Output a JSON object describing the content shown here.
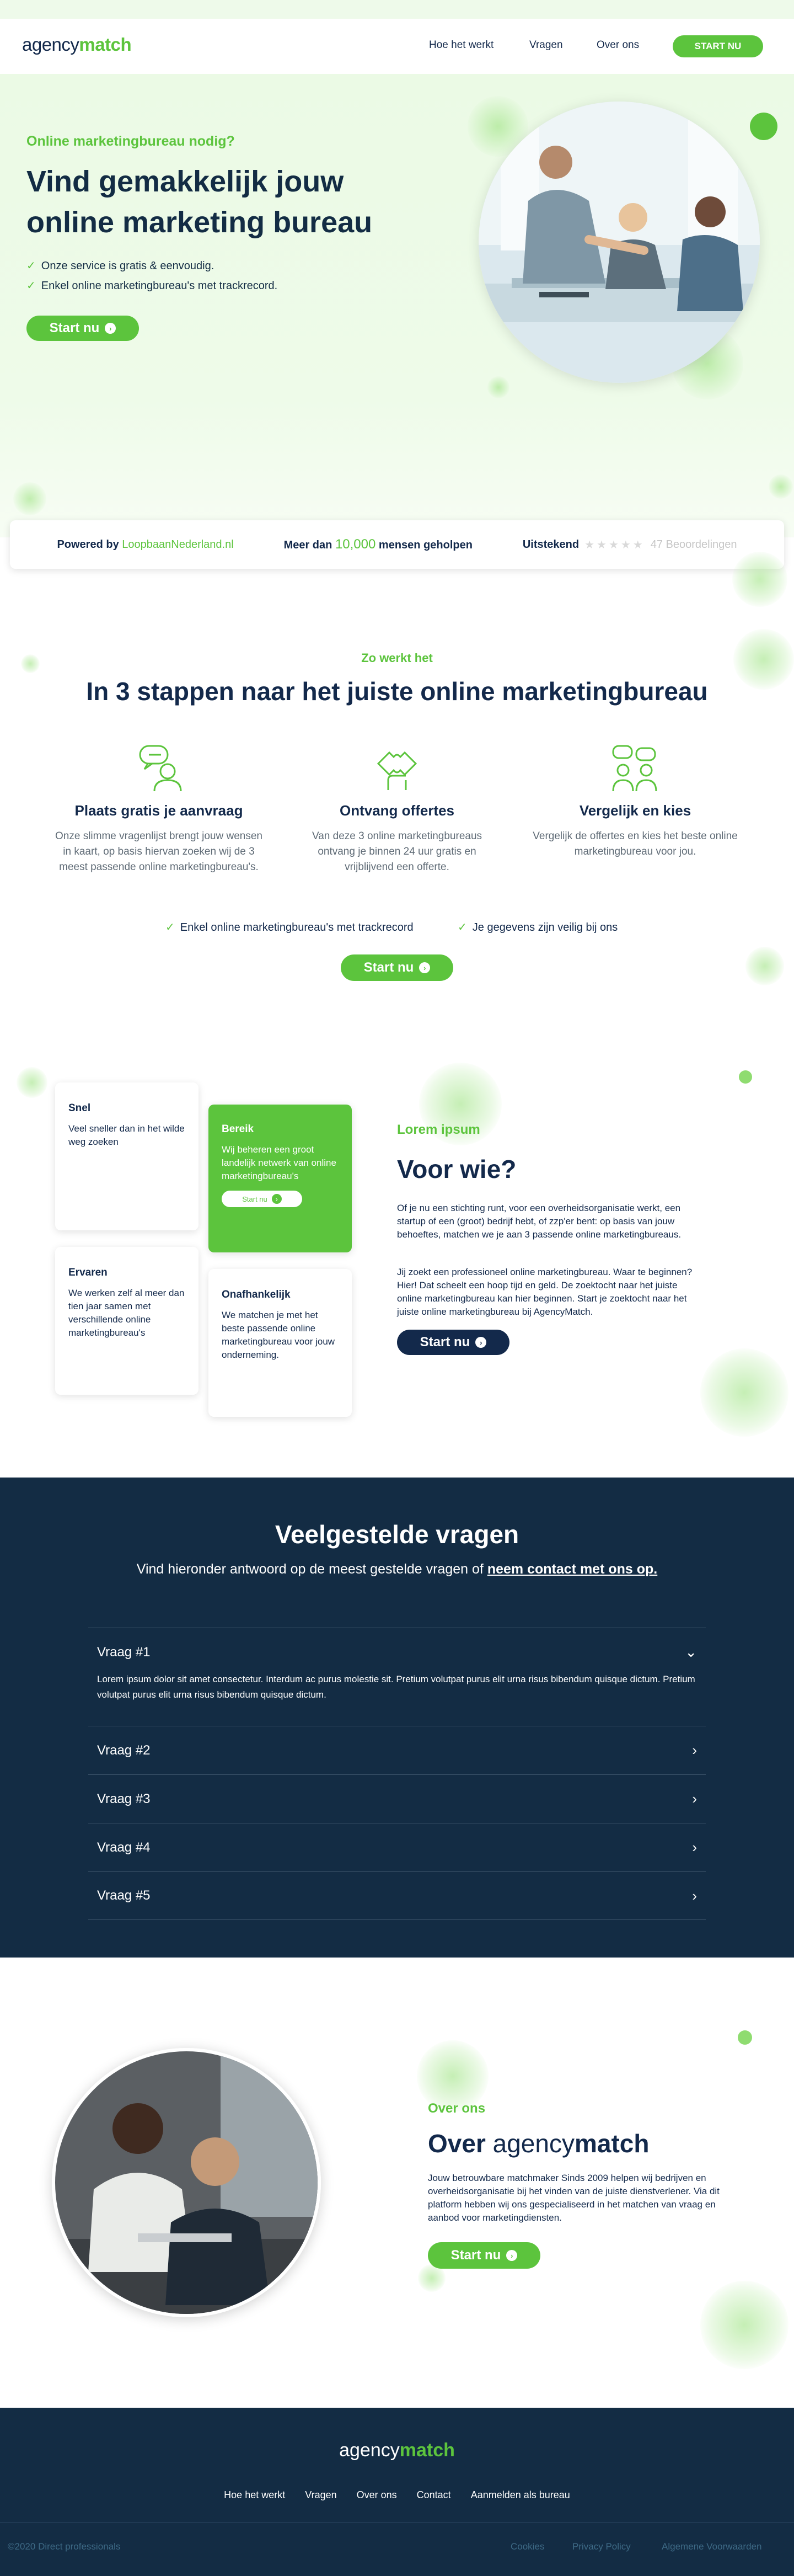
{
  "header": {
    "logo_part1": "agency",
    "logo_part2": "match",
    "nav": [
      "Hoe het werkt",
      "Vragen",
      "Over ons"
    ],
    "cta": "START NU"
  },
  "hero": {
    "eyebrow": "Online marketingbureau nodig?",
    "title_line1": "Vind gemakkelijk jouw",
    "title_line2": "online marketing bureau",
    "bullets": [
      "Onze service is gratis & eenvoudig.",
      "Enkel online marketingbureau's met trackrecord."
    ],
    "cta": "Start nu"
  },
  "stats": {
    "powered_prefix": "Powered by",
    "powered_brand": "LoopbaanNederland.nl",
    "helped_prefix": "Meer dan",
    "helped_count": "10,000",
    "helped_suffix": "mensen geholpen",
    "rating_label": "Uitstekend",
    "stars": 5,
    "reviews": "47 Beoordelingen"
  },
  "how": {
    "eyebrow": "Zo werkt het",
    "title": "In 3 stappen naar het juiste online marketingbureau",
    "steps": [
      {
        "icon": "chat-person-icon",
        "title": "Plaats gratis je aanvraag",
        "text": "Onze slimme vragenlijst brengt jouw wensen in kaart, op basis hiervan zoeken wij de 3 meest passende online marketingbureau's."
      },
      {
        "icon": "puzzle-hand-icon",
        "title": "Ontvang offertes",
        "text": "Van deze 3 online marketingbureaus ontvang je binnen 24 uur gratis en vrijblijvend een offerte."
      },
      {
        "icon": "compare-people-icon",
        "title": "Vergelijk en kies",
        "text": "Vergelijk de offertes en kies het beste online marketingbureau voor jou."
      }
    ],
    "checks": [
      "Enkel online marketingbureau's met trackrecord",
      "Je gegevens zijn veilig bij ons"
    ],
    "cta": "Start nu"
  },
  "who": {
    "cards": [
      {
        "title": "Snel",
        "text": "Veel sneller dan in het wilde weg zoeken"
      },
      {
        "title": "Bereik",
        "text": "Wij beheren een groot landelijk netwerk van online marketingbureau's",
        "cta": "Start nu"
      },
      {
        "title": "Ervaren",
        "text": "We werken zelf al meer dan tien jaar samen met verschillende online marketingbureau's"
      },
      {
        "title": "Onafhankelijk",
        "text": "We matchen je met het beste passende online marketingbureau voor jouw onderneming."
      }
    ],
    "eyebrow": "Lorem ipsum",
    "title": "Voor wie?",
    "p1": "Of je nu een stichting runt, voor een overheidsorganisatie werkt, een startup of een (groot) bedrijf hebt, of zzp'er bent: op basis van jouw behoeftes, matchen we je aan 3 passende online marketingbureaus.",
    "p2": "Jij zoekt een professioneel online marketingbureau. Waar te beginnen? Hier! Dat scheelt een hoop tijd en geld. De zoektocht naar het juiste online marketingbureau kan hier beginnen. Start je zoektocht naar het juiste online marketingbureau bij AgencyMatch.",
    "cta": "Start nu"
  },
  "faq": {
    "title": "Veelgestelde vragen",
    "subtitle_prefix": "Vind hieronder antwoord op de meest gestelde vragen of",
    "subtitle_link": "neem contact met ons op.",
    "items": [
      {
        "q": "Vraag #1",
        "a": "Lorem ipsum dolor sit amet consectetur. Interdum ac purus molestie sit. Pretium volutpat purus elit urna risus bibendum quisque dictum. Pretium volutpat purus elit urna risus bibendum quisque dictum.",
        "open": true
      },
      {
        "q": "Vraag #2"
      },
      {
        "q": "Vraag #3"
      },
      {
        "q": "Vraag #4"
      },
      {
        "q": "Vraag #5"
      }
    ]
  },
  "about": {
    "eyebrow": "Over ons",
    "title_prefix": "Over",
    "title_part1": "agency",
    "title_part2": "match",
    "text": "Jouw betrouwbare matchmaker Sinds 2009 helpen wij bedrijven en overheidsorganisatie bij het vinden van de juiste dienstverlener. Via dit platform hebben wij ons gespecialiseerd in het matchen van vraag en aanbod voor marketingdiensten.",
    "cta": "Start nu"
  },
  "footer": {
    "logo_part1": "agency",
    "logo_part2": "match",
    "nav": [
      "Hoe het werkt",
      "Vragen",
      "Over ons",
      "Contact",
      "Aanmelden als bureau"
    ],
    "copyright": "©2020 Direct professionals",
    "links": [
      "Cookies",
      "Privacy Policy",
      "Algemene Voorwaarden"
    ]
  },
  "colors": {
    "green": "#5cc43d",
    "navy": "#13294b",
    "faq_bg": "#132c44"
  }
}
